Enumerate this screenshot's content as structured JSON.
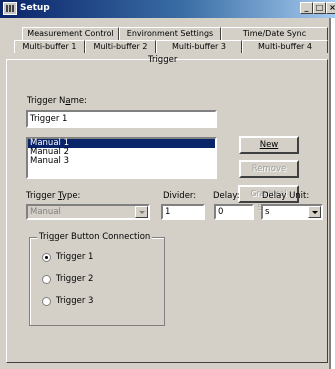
{
  "window": {
    "title": "Setup"
  },
  "tabs": {
    "row1": [
      "Measurement Control",
      "Environment Settings",
      "Time/Date Sync"
    ],
    "row2": [
      "Multi-buffer 1",
      "Multi-buffer 2",
      "Multi-buffer 3",
      "Multi-buffer 4"
    ],
    "active": "Trigger"
  },
  "trigger_name": {
    "label": "Trigger Name:",
    "value": "Trigger 1"
  },
  "trigger_list": {
    "items": [
      "Manual 1",
      "Manual 2",
      "Manual 3"
    ],
    "selected": 0
  },
  "buttons": {
    "new": "New",
    "remove": "Remove",
    "graphical_setup": "Graphical Setup"
  },
  "trigger_type": {
    "label": "Trigger Type:",
    "value": "Manual"
  },
  "divider": {
    "label": "Divider:",
    "value": "1"
  },
  "delay": {
    "label": "Delay:",
    "value": "0"
  },
  "delay_unit": {
    "label": "Delay Unit:",
    "value": "s"
  },
  "trigger_button_connection": {
    "label": "Trigger Button Connection",
    "options": [
      "Trigger 1",
      "Trigger 2",
      "Trigger 3"
    ],
    "selected": 0
  }
}
